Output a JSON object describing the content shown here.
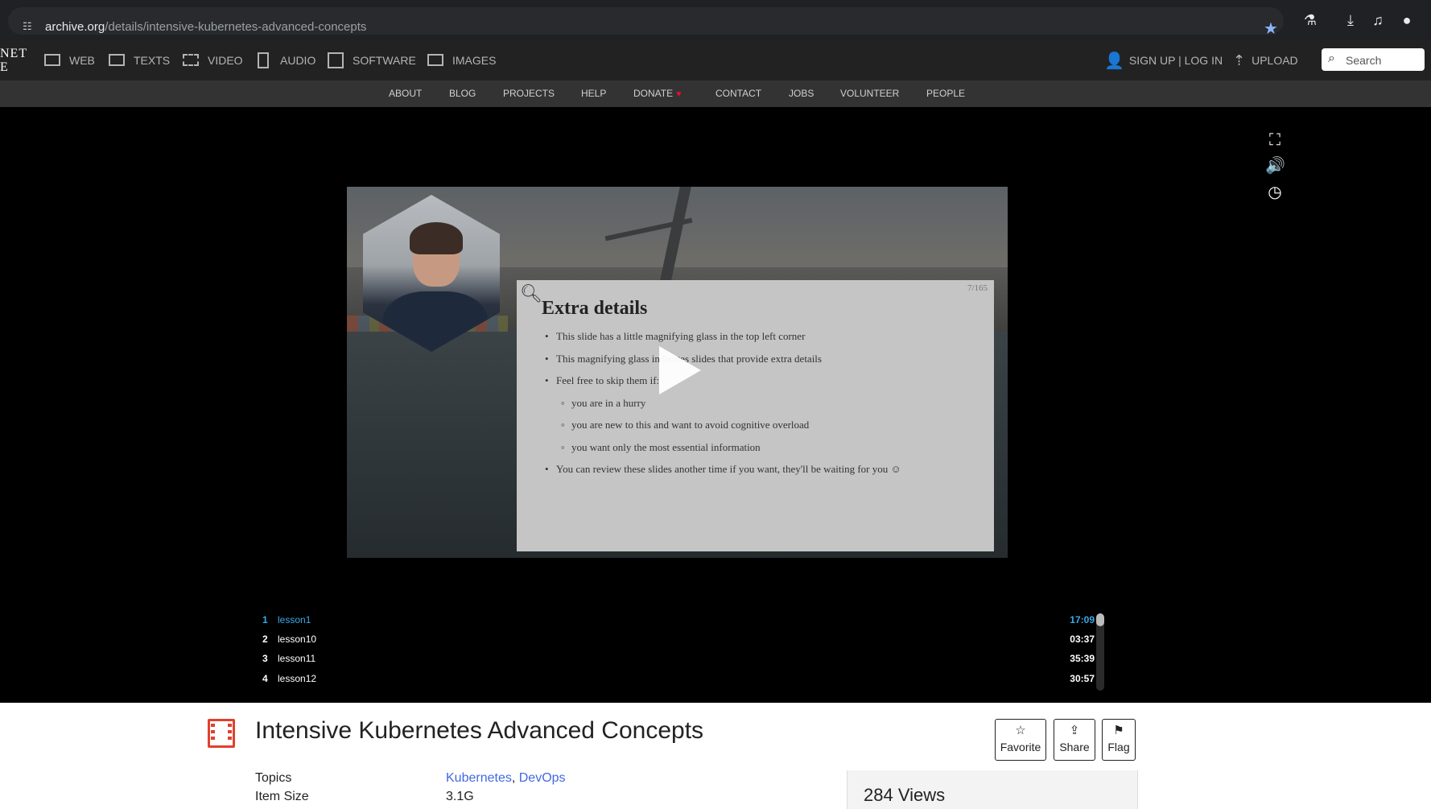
{
  "browser": {
    "url_host": "archive.org",
    "url_path": "/details/intensive-kubernetes-advanced-concepts"
  },
  "ia_nav": {
    "logo_fragment_line1": "NET",
    "logo_fragment_line2": "E",
    "media": [
      {
        "label": "WEB",
        "icon": "web-icon"
      },
      {
        "label": "TEXTS",
        "icon": "texts-icon"
      },
      {
        "label": "VIDEO",
        "icon": "video-icon"
      },
      {
        "label": "AUDIO",
        "icon": "audio-icon"
      },
      {
        "label": "SOFTWARE",
        "icon": "software-icon"
      },
      {
        "label": "IMAGES",
        "icon": "images-icon"
      }
    ],
    "signup_login": "SIGN UP | LOG IN",
    "upload": "UPLOAD",
    "search_placeholder": "Search"
  },
  "sub_nav": [
    "ABOUT",
    "BLOG",
    "PROJECTS",
    "HELP",
    "DONATE",
    "CONTACT",
    "JOBS",
    "VOLUNTEER",
    "PEOPLE"
  ],
  "slide": {
    "page_num": "7/165",
    "title": "Extra details",
    "bullets": [
      "This slide has a little magnifying glass in the top left corner",
      "This magnifying glass indicates slides that provide extra details",
      "Feel free to skip them if:",
      "you are in a hurry",
      "you are new to this and want to avoid cognitive overload",
      "you want only the most essential information",
      "You can review these slides another time if you want, they'll be waiting for you ☺"
    ]
  },
  "playlist": [
    {
      "num": "1",
      "name": "lesson1",
      "time": "17:09",
      "active": true
    },
    {
      "num": "2",
      "name": "lesson10",
      "time": "03:37",
      "active": false
    },
    {
      "num": "3",
      "name": "lesson11",
      "time": "35:39",
      "active": false
    },
    {
      "num": "4",
      "name": "lesson12",
      "time": "30:57",
      "active": false
    }
  ],
  "item": {
    "title": "Intensive Kubernetes Advanced Concepts",
    "actions": {
      "favorite": "Favorite",
      "share": "Share",
      "flag": "Flag"
    },
    "topics_label": "Topics",
    "topics": [
      "Kubernetes",
      "DevOps"
    ],
    "topics_sep": ", ",
    "size_label": "Item Size",
    "size_value": "3.1G",
    "views": "284 Views"
  },
  "colors": {
    "accent_link": "#4169e1",
    "playlist_active": "#3aaae6",
    "film_icon": "#e0412e",
    "donate_heart": "#e0102b"
  }
}
